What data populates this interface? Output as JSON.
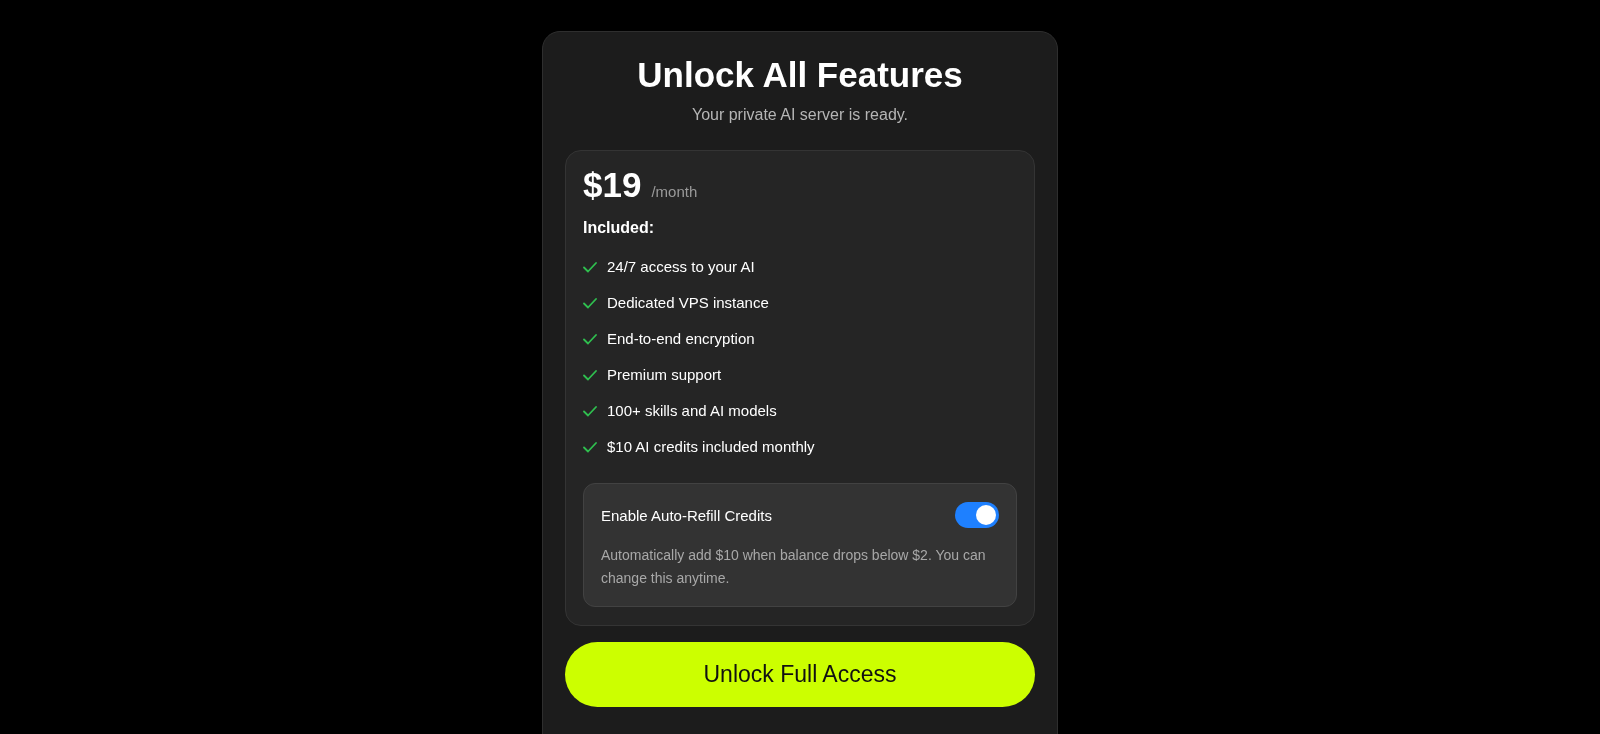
{
  "title": "Unlock All Features",
  "subtitle": "Your private AI server is ready.",
  "plan": {
    "price": "$19",
    "period": "/month",
    "included_label": "Included:",
    "features": [
      "24/7 access to your AI",
      "Dedicated VPS instance",
      "End-to-end encryption",
      "Premium support",
      "100+ skills and AI models",
      "$10 AI credits included monthly"
    ],
    "auto_refill": {
      "label": "Enable Auto-Refill Credits",
      "on": true,
      "description": "Automatically add $10 when balance drops below $2. You can change this anytime."
    }
  },
  "cta": "Unlock Full Access"
}
